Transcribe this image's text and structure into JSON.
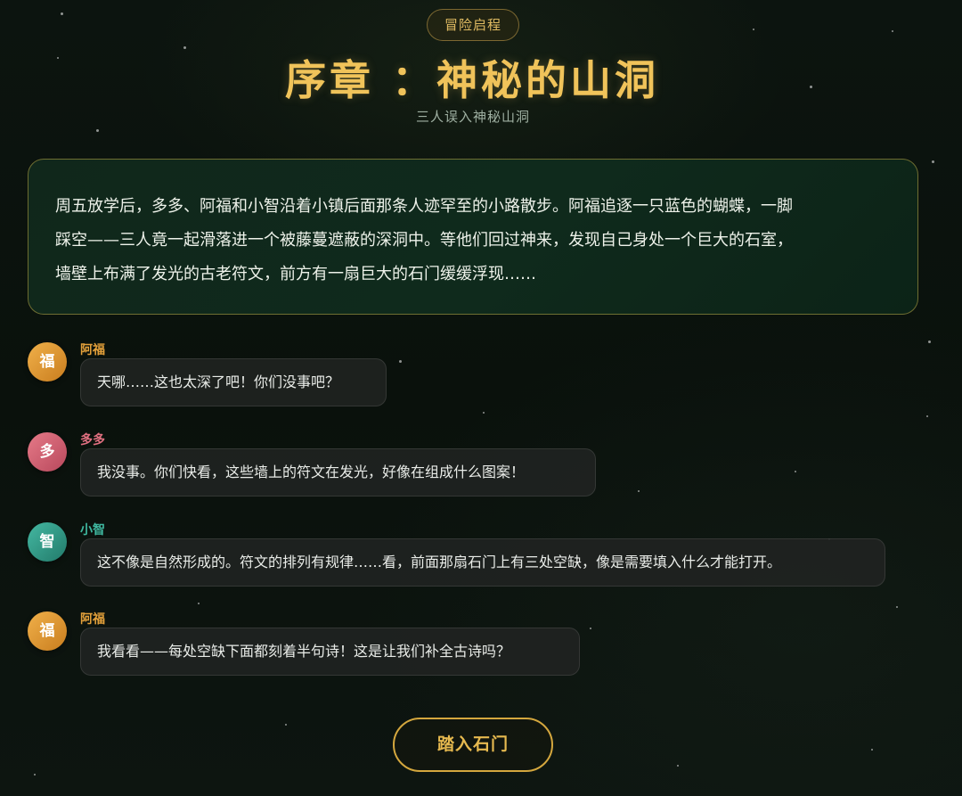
{
  "header": {
    "badge": "冒险启程",
    "title": "序章 ：神秘的山洞",
    "subtitle": "三人误入神秘山洞"
  },
  "story": {
    "lines": [
      "周五放学后，多多、阿福和小智沿着小镇后面那条人迹罕至的小路散步。阿福追逐一只蓝色的蝴蝶，一脚",
      "踩空——三人竟一起滑落进一个被藤蔓遮蔽的深洞中。等他们回过神来，发现自己身处一个巨大的石室，",
      "墙壁上布满了发光的古老符文，前方有一扇巨大的石门缓缓浮现……"
    ]
  },
  "characters": {
    "afu": {
      "name": "阿福",
      "avatar": "福",
      "color": "#e3a03a",
      "gradient_from": "#f0b04a",
      "gradient_to": "#c97d1e"
    },
    "duoduo": {
      "name": "多多",
      "avatar": "多",
      "color": "#e07080",
      "gradient_from": "#e67a88",
      "gradient_to": "#b8485c"
    },
    "xiaozhi": {
      "name": "小智",
      "avatar": "智",
      "color": "#3fb8a0",
      "gradient_from": "#44b8a2",
      "gradient_to": "#227a6a"
    }
  },
  "dialogue": [
    {
      "speaker": "阿福",
      "avatar": "福",
      "text": "天哪……这也太深了吧！你们没事吧？"
    },
    {
      "speaker": "多多",
      "avatar": "多",
      "text": "我没事。你们快看，这些墙上的符文在发光，好像在组成什么图案！"
    },
    {
      "speaker": "小智",
      "avatar": "智",
      "text": "这不像是自然形成的。符文的排列有规律……看，前面那扇石门上有三处空缺，像是需要填入什么才能打开。"
    },
    {
      "speaker": "阿福",
      "avatar": "福",
      "text": "我看看——每处空缺下面都刻着半句诗！这是让我们补全古诗吗？"
    }
  ],
  "actions": {
    "enter_label": "踏入石门"
  }
}
